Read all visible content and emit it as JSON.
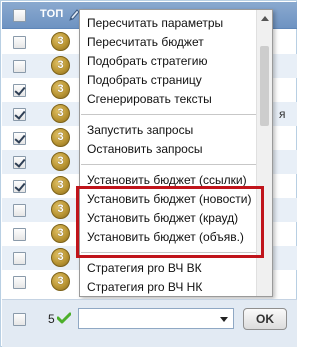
{
  "header": {
    "top_label": "ТОП"
  },
  "rows": [
    {
      "checked": false,
      "rank": "3",
      "text": ""
    },
    {
      "checked": false,
      "rank": "3",
      "text": ""
    },
    {
      "checked": true,
      "rank": "3",
      "text": ""
    },
    {
      "checked": true,
      "rank": "3",
      "text": "я"
    },
    {
      "checked": true,
      "rank": "3",
      "text": ""
    },
    {
      "checked": true,
      "rank": "3",
      "text": ""
    },
    {
      "checked": true,
      "rank": "3",
      "text": ""
    },
    {
      "checked": false,
      "rank": "3",
      "text": ""
    },
    {
      "checked": false,
      "rank": "3",
      "text": ""
    },
    {
      "checked": false,
      "rank": "3",
      "text": ""
    },
    {
      "checked": false,
      "rank": "3",
      "text": ""
    }
  ],
  "menu": {
    "group1": [
      "Пересчитать параметры",
      "Пересчитать бюджет",
      "Подобрать стратегию",
      "Подобрать страницу",
      "Сгенерировать тексты"
    ],
    "group2": [
      "Запустить запросы",
      "Остановить запросы"
    ],
    "group3": [
      "Установить бюджет (ссылки)",
      "Установить бюджет (новости)",
      "Установить бюджет (крауд)",
      "Установить бюджет (объяв.)"
    ],
    "group4": [
      "Стратегия pro ВЧ ВК",
      "Стратегия pro ВЧ НК"
    ]
  },
  "footer": {
    "count": "5",
    "select_value": "",
    "ok_label": "OK"
  },
  "colors": {
    "header_bg": "#7a9dc8",
    "highlight": "#c0141b",
    "badge": "#b99533",
    "check": "#4caf2a"
  },
  "icons": {
    "edit": "pencil-icon",
    "rank": "rank-badge-icon",
    "ok": "green-check-icon"
  }
}
